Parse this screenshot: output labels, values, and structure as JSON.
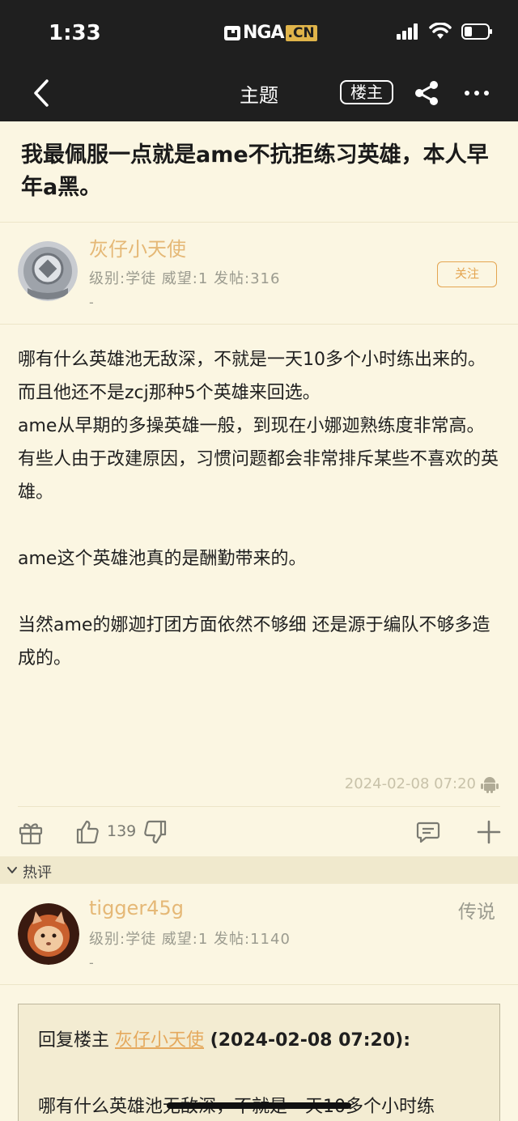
{
  "status_bar": {
    "time": "1:33",
    "brand_text": "NGA",
    "brand_badge": ".CN",
    "icons": [
      "signal-icon",
      "wifi-icon",
      "battery-icon"
    ]
  },
  "nav": {
    "back_icon": "back-chevron-icon",
    "title": "主题",
    "op_filter_label": "楼主",
    "share_icon": "share-icon",
    "more_icon": "more-icon"
  },
  "topic": {
    "title": "我最佩服一点就是ame不抗拒练习英雄，本人早年a黑。"
  },
  "op": {
    "username": "灰仔小天使",
    "meta": "级别:学徒  威望:1  发帖:316",
    "dash": "-",
    "follow_label": "关注",
    "body": [
      "哪有什么英雄池无敌深，不就是一天10多个小时练出来的。",
      "而且他还不是zcj那种5个英雄来回选。",
      "ame从早期的多操英雄一般，到现在小娜迦熟练度非常高。",
      "有些人由于改建原因，习惯问题都会非常排斥某些不喜欢的英雄。",
      "",
      "ame这个英雄池真的是酬勤带来的。",
      "",
      "当然ame的娜迦打团方面依然不够细 还是源于编队不够多造成的。"
    ],
    "time": "2024-02-08 07:20",
    "device_icon": "android-icon",
    "like_count": "139"
  },
  "actions": {
    "icons": [
      "gift-icon",
      "thumbs-up-icon",
      "thumbs-down-icon",
      "comment-icon",
      "plus-icon"
    ]
  },
  "hot_section": {
    "label": "热评"
  },
  "reply": {
    "username": "tigger45g",
    "rank": "传说",
    "meta": "级别:学徒  威望:1  发帖:1140",
    "dash": "-",
    "quote_prefix": "回复楼主 ",
    "quote_name": "灰仔小天使",
    "quote_time": " (2024-02-08 07:20):",
    "quote_text": "哪有什么英雄池无敌深，不就是一天10多个小时练"
  },
  "colors": {
    "background": "#fbf6e2",
    "header": "#1f1f1f",
    "username": "#e5b876",
    "follow": "#e4a551",
    "meta": "#9b9b8f"
  }
}
